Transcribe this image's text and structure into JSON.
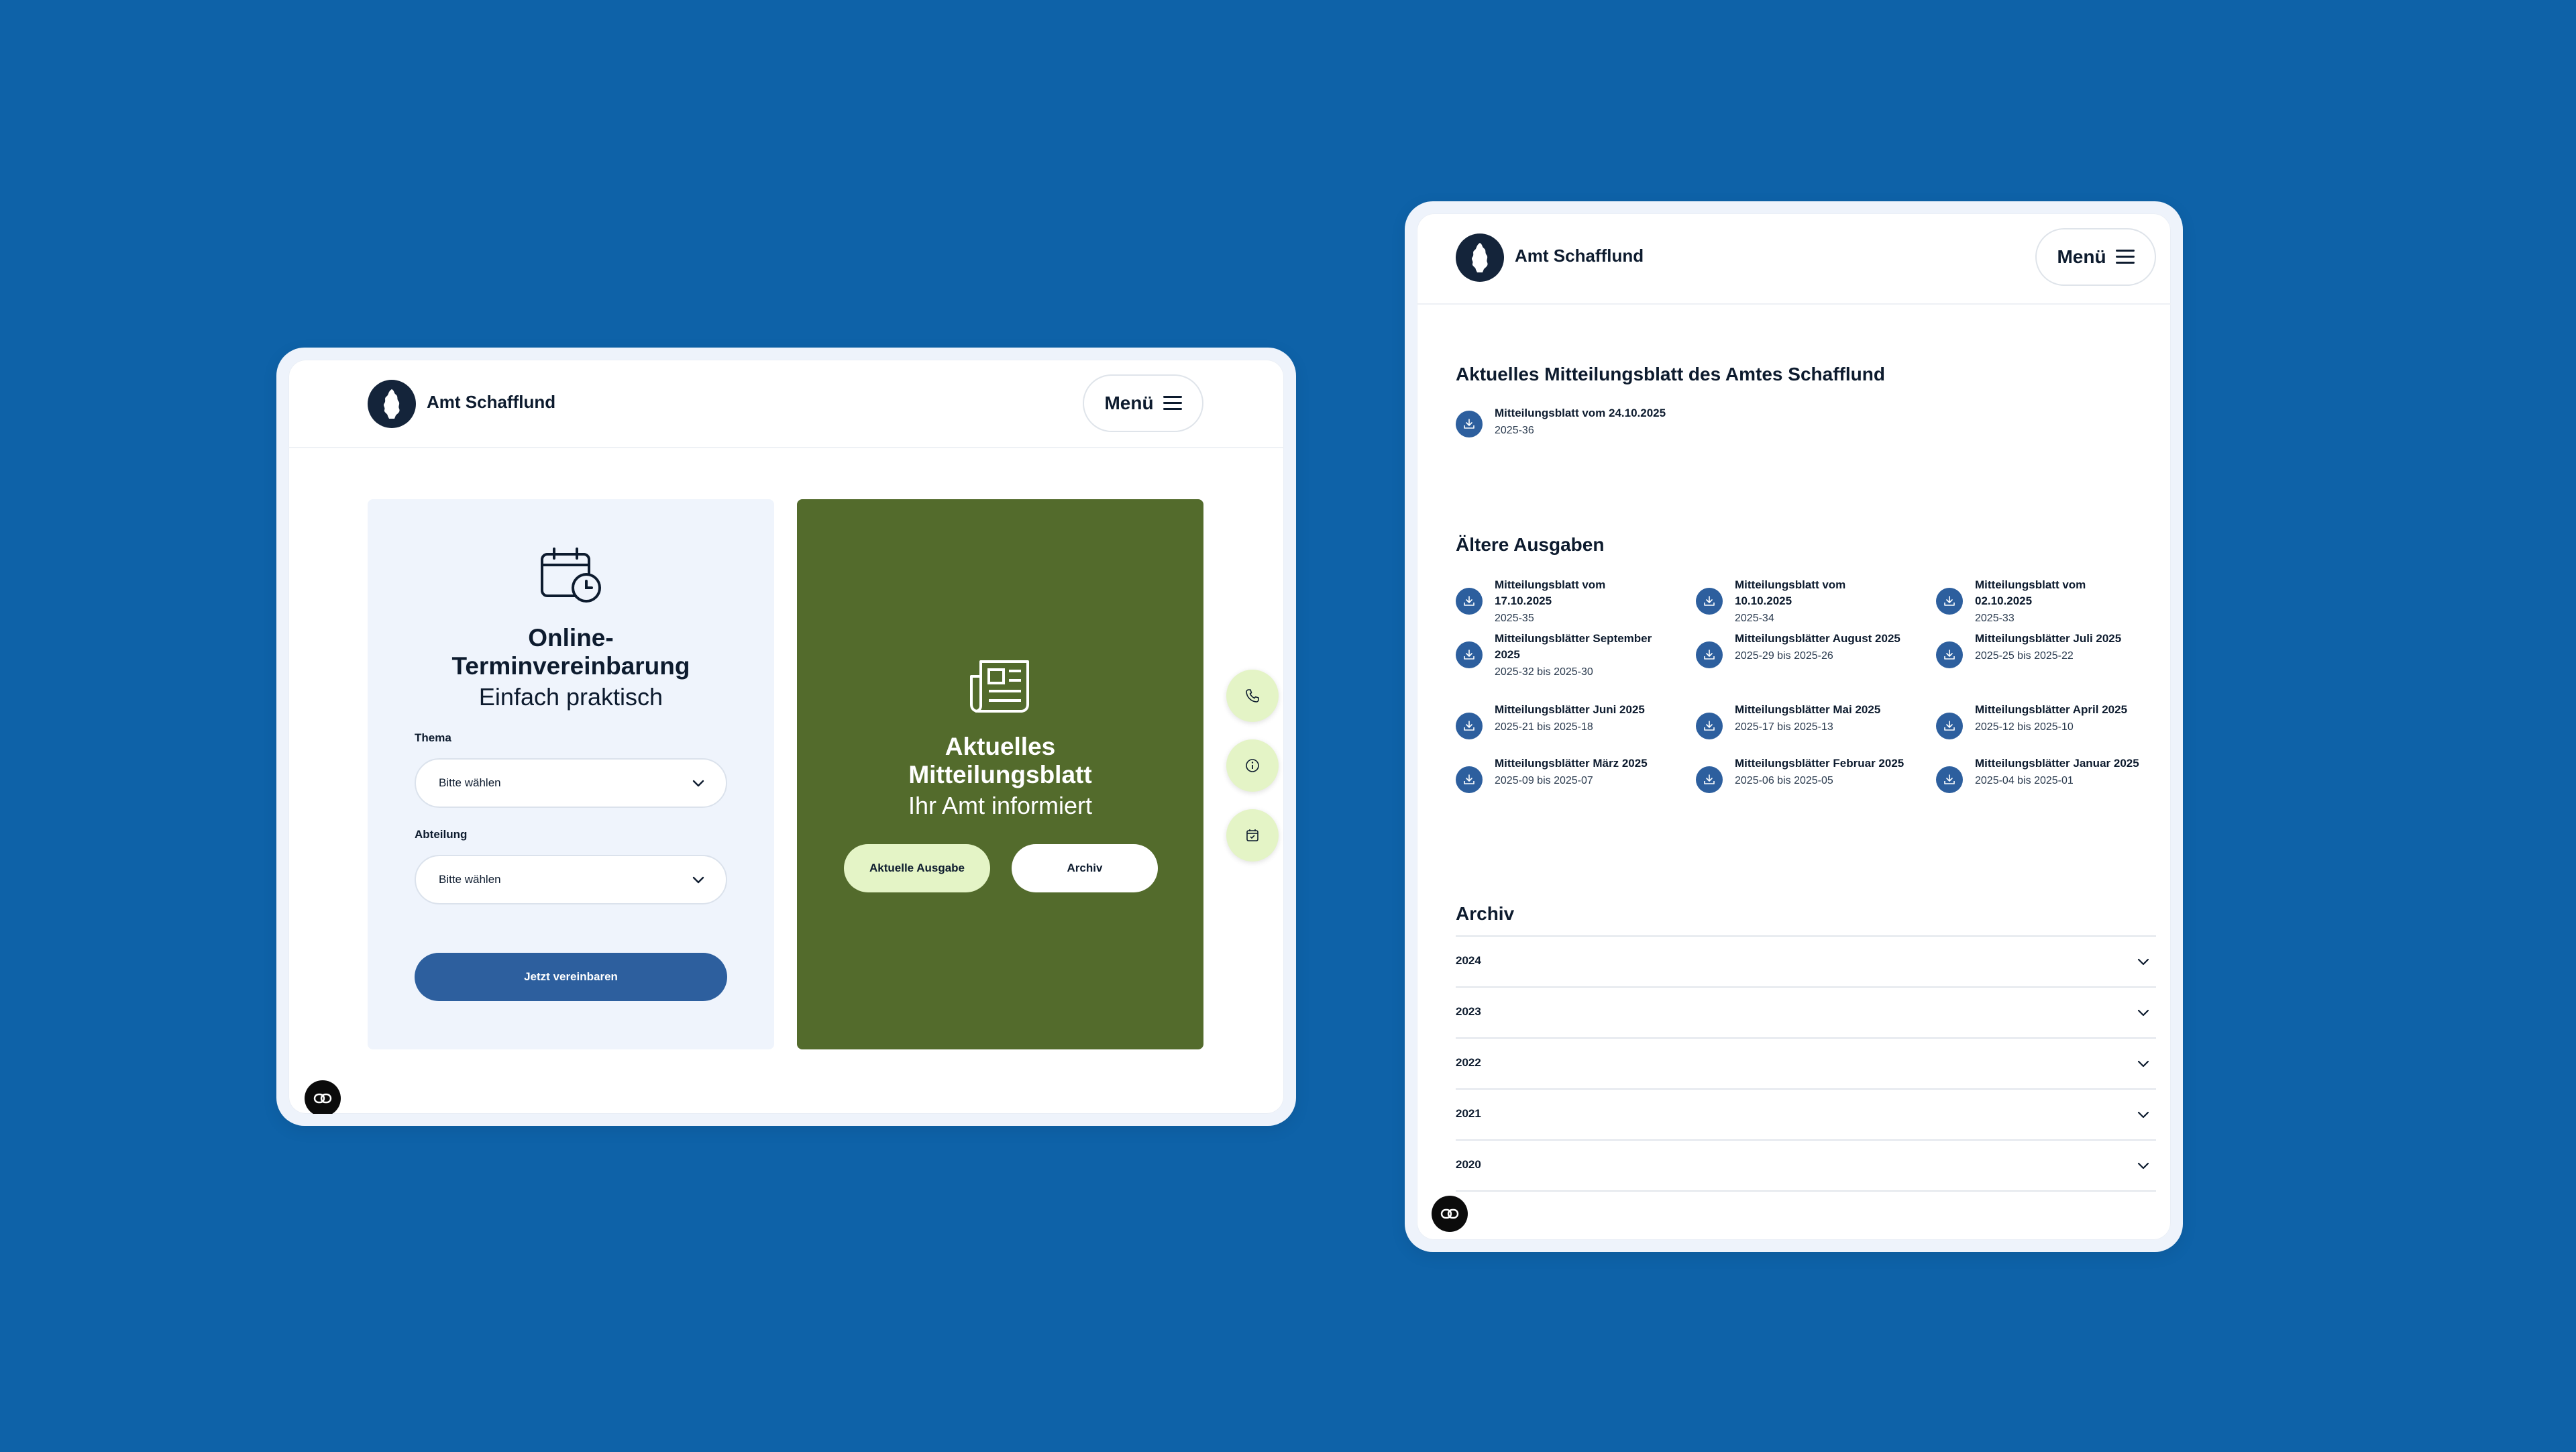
{
  "brand": {
    "name": "Amt Schafflund"
  },
  "header": {
    "menu_label": "Menü"
  },
  "termin": {
    "title_line1": "Online-",
    "title_line2": "Terminvereinbarung",
    "subtitle": "Einfach praktisch",
    "thema_label": "Thema",
    "thema_value": "Bitte wählen",
    "abteilung_label": "Abteilung",
    "abteilung_value": "Bitte wählen",
    "submit_label": "Jetzt vereinbaren"
  },
  "mitteilungsblatt_card": {
    "title_line1": "Aktuelles",
    "title_line2": "Mitteilungsblatt",
    "subtitle": "Ihr Amt informiert",
    "current_button": "Aktuelle Ausgabe",
    "archive_button": "Archiv"
  },
  "side_actions": [
    "phone-icon",
    "info-icon",
    "calendar-check-icon"
  ],
  "current_issue": {
    "section_title": "Aktuelles Mitteilungsblatt des Amtes Schafflund",
    "title": "Mitteilungsblatt vom 24.10.2025",
    "id": "2025-36"
  },
  "older": {
    "section_title": "Ältere Ausgaben",
    "items": [
      {
        "title": "Mitteilungsblatt vom 17.10.2025",
        "sub": "2025-35"
      },
      {
        "title": "Mitteilungsblatt vom 10.10.2025",
        "sub": "2025-34"
      },
      {
        "title": "Mitteilungsblatt vom 02.10.2025",
        "sub": "2025-33"
      },
      {
        "title": "Mitteilungsblätter September 2025",
        "sub": "2025-32 bis 2025-30"
      },
      {
        "title": "Mitteilungsblätter August 2025",
        "sub": "2025-29 bis 2025-26"
      },
      {
        "title": "Mitteilungsblätter Juli 2025",
        "sub": "2025-25 bis 2025-22"
      },
      {
        "title": "Mitteilungsblätter Juni 2025",
        "sub": "2025-21 bis 2025-18"
      },
      {
        "title": "Mitteilungsblätter Mai 2025",
        "sub": "2025-17 bis 2025-13"
      },
      {
        "title": "Mitteilungsblätter April 2025",
        "sub": "2025-12 bis 2025-10"
      },
      {
        "title": "Mitteilungsblätter März 2025",
        "sub": "2025-09 bis 2025-07"
      },
      {
        "title": "Mitteilungsblätter Februar 2025",
        "sub": "2025-06 bis 2025-05"
      },
      {
        "title": "Mitteilungsblätter Januar 2025",
        "sub": "2025-04 bis 2025-01"
      }
    ]
  },
  "archive": {
    "section_title": "Archiv",
    "years": [
      "2024",
      "2023",
      "2022",
      "2021",
      "2020"
    ]
  },
  "colors": {
    "background": "#0e62a8",
    "navy": "#14243a",
    "primary_button": "#2d5f9e",
    "green_card": "#536b2c",
    "lime_accent": "#e4f4c6"
  }
}
